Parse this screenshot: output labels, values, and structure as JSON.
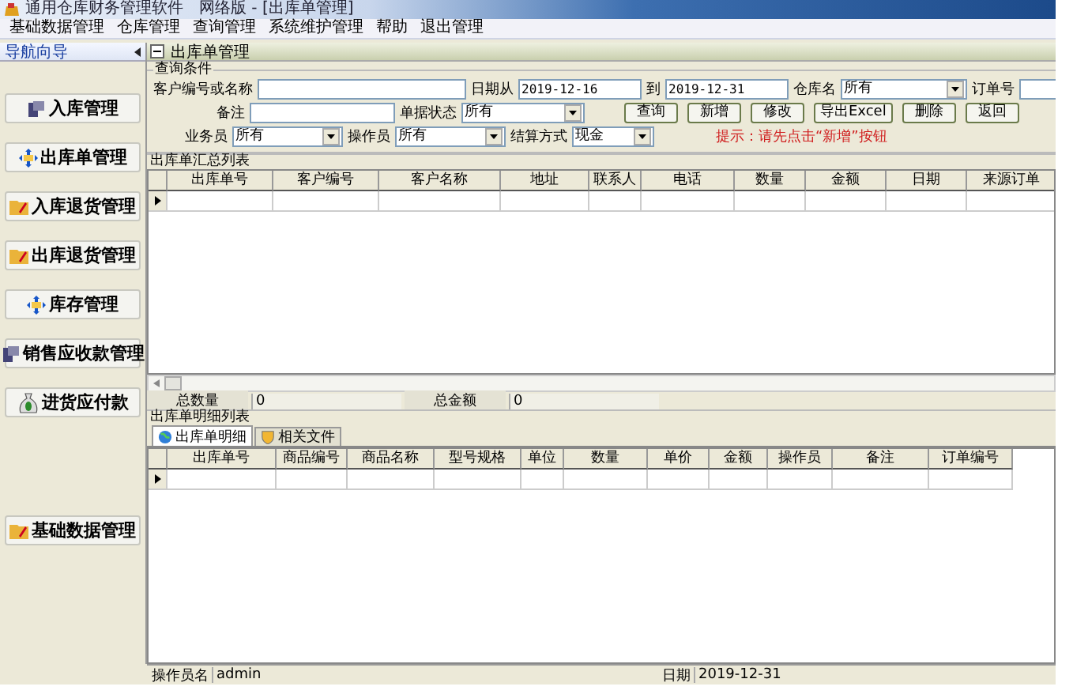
{
  "window": {
    "title": "通用仓库财务管理软件　网络版 - [出库单管理]"
  },
  "menu": [
    "基础数据管理",
    "仓库管理",
    "查询管理",
    "系统维护管理",
    "帮助",
    "退出管理"
  ],
  "sidebar": {
    "title": "导航向导",
    "items": [
      {
        "label": "入库管理",
        "kind": "door"
      },
      {
        "label": "出库单管理",
        "kind": "arrows"
      },
      {
        "label": "入库退货管理",
        "kind": "folder"
      },
      {
        "label": "出库退货管理",
        "kind": "folder"
      },
      {
        "label": "库存管理",
        "kind": "arrows"
      },
      {
        "label": "销售应收款管理",
        "kind": "door"
      },
      {
        "label": "进货应付款",
        "kind": "moneybag"
      },
      {
        "label": "基础数据管理",
        "kind": "folder"
      }
    ]
  },
  "panel": {
    "title": "出库单管理",
    "expanded": true
  },
  "query": {
    "title": "查询条件",
    "customer": {
      "label": "客户编号或名称"
    },
    "date_from": {
      "label": "日期从",
      "value": "2019-12-16"
    },
    "date_to": {
      "label": "到",
      "value": "2019-12-31"
    },
    "warehouse": {
      "label": "仓库名",
      "value": "所有"
    },
    "order_no": {
      "label": "订单号"
    },
    "note": {
      "label": "备注"
    },
    "status": {
      "label": "单据状态",
      "value": "所有"
    },
    "salesman": {
      "label": "业务员",
      "value": "所有"
    },
    "operator": {
      "label": "操作员",
      "value": "所有"
    },
    "payment": {
      "label": "结算方式",
      "value": "现金"
    },
    "buttons": [
      "查询",
      "新增",
      "修改",
      "导出Excel",
      "删除",
      "返回"
    ],
    "hint": "提示：请先点击“新增”按钮"
  },
  "summary": {
    "title": "出库单汇总列表",
    "columns": [
      "出库单号",
      "客户编号",
      "客户名称",
      "地址",
      "联系人",
      "电话",
      "数量",
      "金额",
      "日期",
      "来源订单"
    ]
  },
  "totals": [
    {
      "label": "总数量",
      "value": "0"
    },
    {
      "label": "总金额",
      "value": "0"
    }
  ],
  "details": {
    "title": "出库单明细列表",
    "tabs": [
      {
        "label": "出库单明细",
        "selected": true,
        "kind": "globe"
      },
      {
        "label": "相关文件",
        "selected": false,
        "kind": "shield"
      }
    ],
    "columns": [
      "出库单号",
      "商品编号",
      "商品名称",
      "型号规格",
      "单位",
      "数量",
      "单价",
      "金额",
      "操作员",
      "备注",
      "订单编号"
    ]
  },
  "status_bar": {
    "operator_label": "操作员名",
    "operator": "admin",
    "date_label": "日期",
    "date": "2019-12-31"
  }
}
